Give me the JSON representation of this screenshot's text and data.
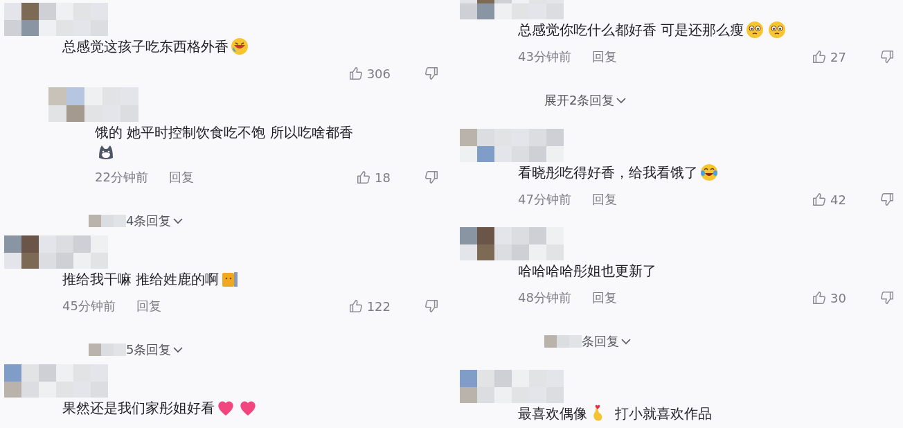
{
  "columns": [
    {
      "items": [
        {
          "kind": "comment",
          "reply": false,
          "content": [
            {
              "kind": "text",
              "text": "总感觉这孩子吃东西格外香"
            },
            {
              "kind": "laughing"
            }
          ],
          "likes": "306"
        },
        {
          "kind": "comment",
          "reply": true,
          "content": [
            {
              "kind": "text",
              "text": "饿的 她平时控制饮食吃不饱 所以吃啥都香"
            },
            {
              "kind": "dog"
            }
          ],
          "time": "22分钟前",
          "reply_label": "回复",
          "likes": "18"
        },
        {
          "kind": "expand",
          "censored": true,
          "text": "4条回复"
        },
        {
          "kind": "comment",
          "reply": false,
          "content": [
            {
              "kind": "text",
              "text": "推给我干嘛 推给姓鹿的啊"
            },
            {
              "kind": "cat"
            }
          ],
          "time": "45分钟前",
          "reply_label": "回复",
          "likes": "122"
        },
        {
          "kind": "expand",
          "censored": true,
          "text": "5条回复"
        },
        {
          "kind": "comment",
          "reply": false,
          "content": [
            {
              "kind": "text",
              "text": "果然还是我们家彤姐好看"
            },
            {
              "kind": "heart"
            },
            {
              "kind": "heart"
            }
          ]
        }
      ]
    },
    {
      "items": [
        {
          "kind": "comment",
          "reply": false,
          "content": [
            {
              "kind": "text",
              "text": "总感觉你吃什么都好香 可是还那么瘦"
            },
            {
              "kind": "pleading"
            },
            {
              "kind": "pleading"
            }
          ],
          "time": "43分钟前",
          "reply_label": "回复",
          "likes": "27"
        },
        {
          "kind": "expand",
          "censored": false,
          "text": "展开2条回复"
        },
        {
          "kind": "comment",
          "reply": false,
          "content": [
            {
              "kind": "text",
              "text": "看晓彤吃得好香，给我看饿了"
            },
            {
              "kind": "crying-laugh"
            }
          ],
          "time": "47分钟前",
          "reply_label": "回复",
          "likes": "42"
        },
        {
          "kind": "comment",
          "reply": false,
          "content": [
            {
              "kind": "text",
              "text": "哈哈哈哈彤姐也更新了"
            }
          ],
          "time": "48分钟前",
          "reply_label": "回复",
          "likes": "30"
        },
        {
          "kind": "expand",
          "censored": true,
          "text": "条回复"
        },
        {
          "kind": "comment",
          "reply": false,
          "content": [
            {
              "kind": "text",
              "text": "最喜欢偶像"
            },
            {
              "kind": "finger-heart"
            },
            {
              "kind": "text",
              "text": "打小就喜欢作品"
            }
          ]
        }
      ]
    }
  ]
}
